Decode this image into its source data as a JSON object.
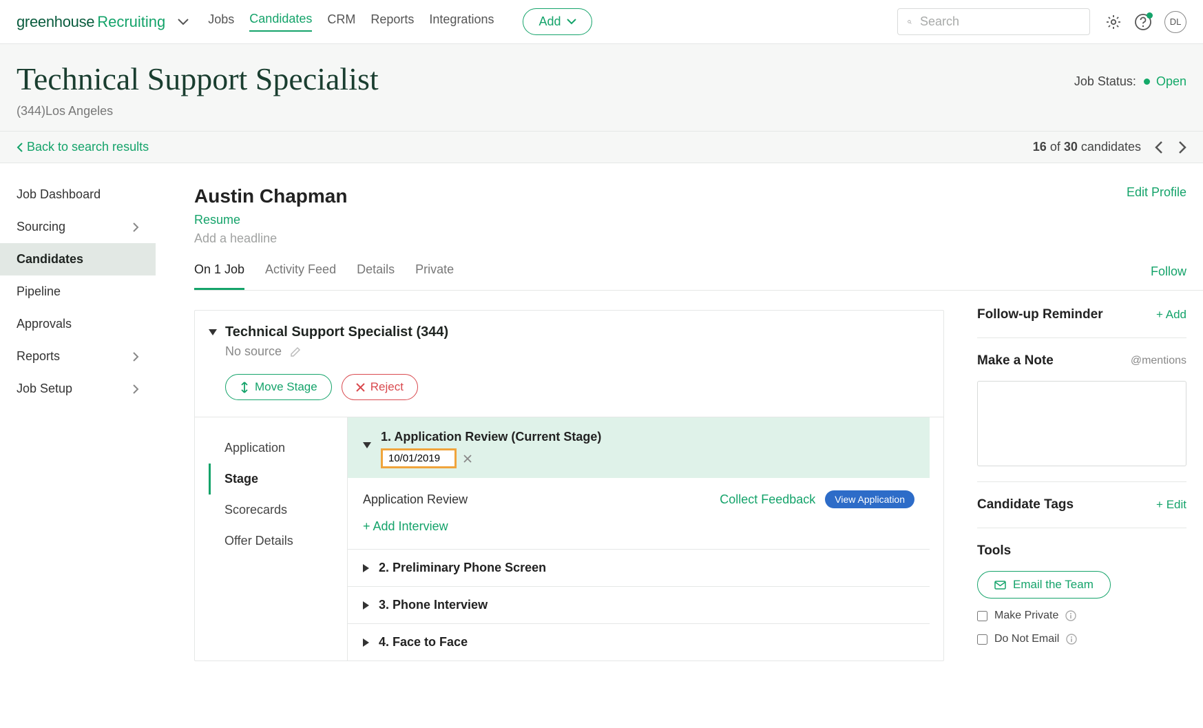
{
  "brand": {
    "greenhouse": "greenhouse",
    "recruiting": "Recruiting"
  },
  "topNav": {
    "links": [
      "Jobs",
      "Candidates",
      "CRM",
      "Reports",
      "Integrations"
    ],
    "activeIndex": 1,
    "add": "Add",
    "searchPlaceholder": "Search",
    "avatarInitials": "DL"
  },
  "pageHeader": {
    "jobTitle": "Technical Support Specialist",
    "jobMeta": "(344)Los Angeles",
    "statusLabel": "Job Status:",
    "statusValue": "Open"
  },
  "subHeader": {
    "back": "Back to search results",
    "countCurrent": "16",
    "countOf": "of",
    "countTotal": "30",
    "countSuffix": "candidates"
  },
  "sidebar": {
    "items": [
      {
        "label": "Job Dashboard",
        "hasChevron": false
      },
      {
        "label": "Sourcing",
        "hasChevron": true
      },
      {
        "label": "Candidates",
        "hasChevron": false
      },
      {
        "label": "Pipeline",
        "hasChevron": false
      },
      {
        "label": "Approvals",
        "hasChevron": false
      },
      {
        "label": "Reports",
        "hasChevron": true
      },
      {
        "label": "Job Setup",
        "hasChevron": true
      }
    ],
    "activeIndex": 2
  },
  "profile": {
    "name": "Austin Chapman",
    "resume": "Resume",
    "headlinePlaceholder": "Add a headline",
    "editProfile": "Edit Profile"
  },
  "tabs": {
    "items": [
      "On 1 Job",
      "Activity Feed",
      "Details",
      "Private"
    ],
    "activeIndex": 0,
    "follow": "Follow"
  },
  "jobPanel": {
    "title": "Technical Support Specialist (344)",
    "noSource": "No source",
    "moveStage": "Move Stage",
    "reject": "Reject",
    "stageTabs": [
      "Application",
      "Stage",
      "Scorecards",
      "Offer Details"
    ],
    "stageActiveIndex": 1,
    "currentStage": {
      "number": "1.",
      "label": "Application Review (Current Stage)",
      "date": "10/01/2019"
    },
    "review": {
      "label": "Application Review",
      "collect": "Collect Feedback",
      "viewApp": "View Application",
      "addInterview": "+ Add Interview"
    },
    "stages": [
      {
        "number": "2.",
        "label": "Preliminary Phone Screen"
      },
      {
        "number": "3.",
        "label": "Phone Interview"
      },
      {
        "number": "4.",
        "label": "Face to Face"
      }
    ]
  },
  "aside": {
    "followup": {
      "title": "Follow-up Reminder",
      "action": "+ Add"
    },
    "note": {
      "title": "Make a Note",
      "mentions": "@mentions"
    },
    "tags": {
      "title": "Candidate Tags",
      "action": "+ Edit"
    },
    "tools": {
      "title": "Tools",
      "emailTeam": "Email the Team",
      "makePrivate": "Make Private",
      "doNotEmail": "Do Not Email"
    }
  }
}
